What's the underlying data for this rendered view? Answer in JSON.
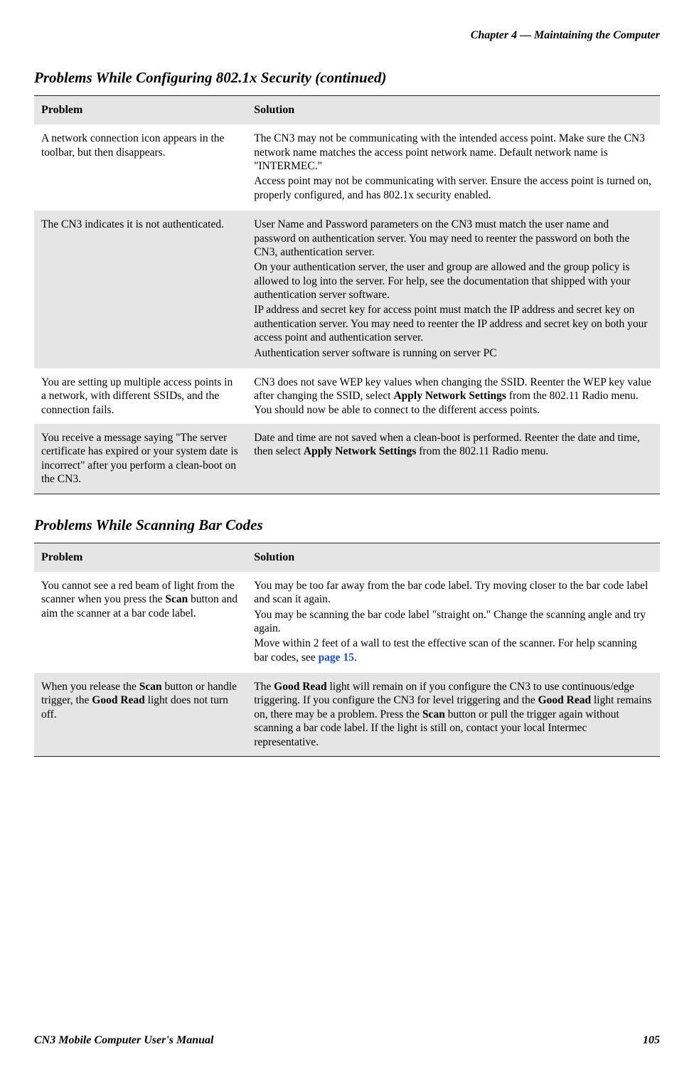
{
  "header": {
    "running": "Chapter 4 —  Maintaining the Computer"
  },
  "section1": {
    "title": "Problems While Configuring 802.1x Security (continued)",
    "headers": {
      "col1": "Problem",
      "col2": "Solution"
    },
    "rows": [
      {
        "problem": "A network connection icon appears in the toolbar, but then disappears.",
        "solution_p1": "The CN3 may not be communicating with the intended access point. Make sure the CN3 network name matches the access point network name. Default network name is \"INTERMEC.\"",
        "solution_p2": "Access point may not be communicating with server. Ensure the access point is turned on, properly configured, and has 802.1x security enabled."
      },
      {
        "problem": "The CN3 indicates it is not authenticated.",
        "solution_p1": "User Name and Password parameters on the CN3 must match the user name and password on authentication server. You may need to reenter the password on both the CN3, authentication server.",
        "solution_p2": "On your authentication server, the user and group are allowed and the group policy is allowed to log into the server. For help, see the documentation that shipped with your authentication server software.",
        "solution_p3": "IP address and secret key for access point must match the IP address and secret key on authentication server. You may need to reenter the IP address and secret key on both your access point and authentication server.",
        "solution_p4": "Authentication server software is running on server PC"
      },
      {
        "problem": "You are setting up multiple access points in a network, with different SSIDs, and the connection fails.",
        "solution_pre": "CN3 does not save WEP key values when changing the SSID. Reenter the WEP key value after changing the SSID, select ",
        "solution_bold": "Apply Network Settings",
        "solution_post": " from the 802.11 Radio menu. You should now be able to connect to the different access points."
      },
      {
        "problem": "You receive a message saying \"The server certificate has expired or your system date is incorrect\" after you perform a clean-boot on the CN3.",
        "solution_pre": "Date and time are not saved when a clean-boot is performed. Reenter the date and time, then select ",
        "solution_bold": "Apply Network Settings",
        "solution_post": " from the 802.11 Radio menu."
      }
    ]
  },
  "section2": {
    "title": "Problems While Scanning Bar Codes",
    "headers": {
      "col1": "Problem",
      "col2": "Solution"
    },
    "rows": [
      {
        "problem_pre": "You cannot see a red beam of light from the scanner when you press the ",
        "problem_bold": "Scan",
        "problem_post": " button and aim the scanner at a bar code label.",
        "solution_p1": "You may be too far away from the bar code label. Try moving closer to the bar code label and scan it again.",
        "solution_p2": "You may be scanning the bar code label \"straight on.\" Change the scanning angle and try again.",
        "solution_p3_pre": "Move within 2 feet of a wall to test the effective scan of the scanner. For help scanning bar codes, see ",
        "solution_p3_link": "page 15",
        "solution_p3_post": "."
      },
      {
        "problem_pre": "When you release the ",
        "problem_bold1": "Scan",
        "problem_mid": " button or handle trigger, the ",
        "problem_bold2": "Good Read",
        "problem_post": " light does not turn off.",
        "sol_pre": "The ",
        "sol_b1": "Good Read",
        "sol_mid1": " light will remain on if you configure the CN3 to use continuous/edge triggering. If you configure the CN3 for level triggering and the ",
        "sol_b2": "Good Read",
        "sol_mid2": " light remains on, there may be a problem. Press the ",
        "sol_b3": "Scan",
        "sol_post": " button or pull the trigger again without scanning a bar code label. If the light is still on, contact your local Intermec representative."
      }
    ]
  },
  "footer": {
    "left": "CN3 Mobile Computer User's Manual",
    "right": "105"
  }
}
